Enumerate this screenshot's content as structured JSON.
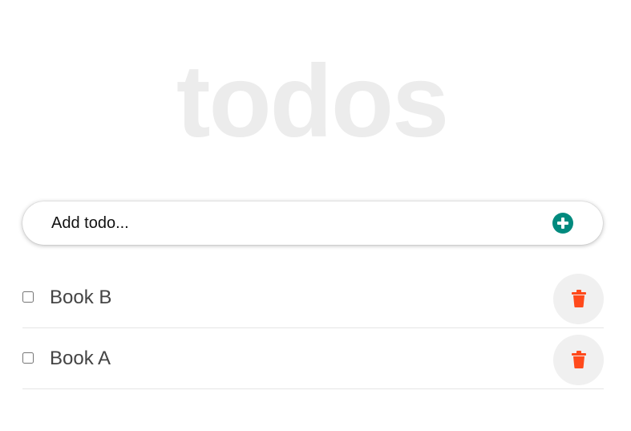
{
  "app": {
    "title": "todos"
  },
  "add_todo": {
    "placeholder": "Add todo...",
    "button_icon": "plus-circle-icon",
    "button_color": "#008a7e"
  },
  "todos": [
    {
      "label": "Book B",
      "completed": false,
      "delete_icon": "trash-icon"
    },
    {
      "label": "Book A",
      "completed": false,
      "delete_icon": "trash-icon"
    }
  ],
  "colors": {
    "title": "#ececec",
    "accent": "#008a7e",
    "delete": "#ff4a1c",
    "todo_text": "#444444"
  }
}
